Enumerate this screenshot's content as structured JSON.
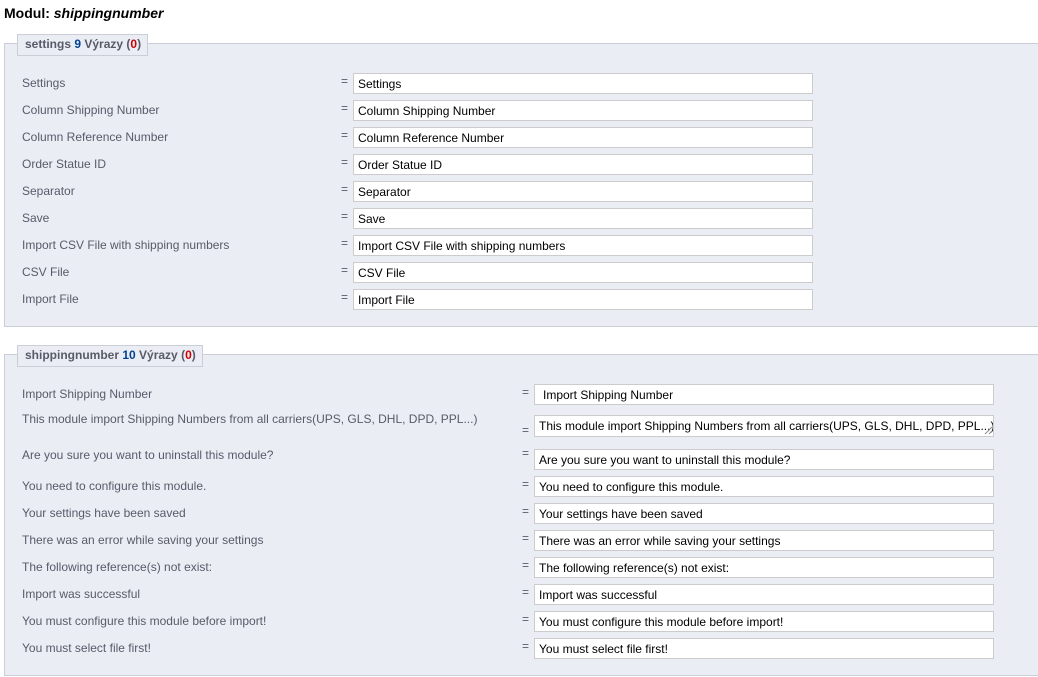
{
  "header": {
    "prefix": "Modul: ",
    "module": "shippingnumber"
  },
  "sections": [
    {
      "name": "settings",
      "count": "9",
      "vyrazy": " Výrazy (",
      "errors": "0",
      "close": ")",
      "rows": [
        {
          "label": "Settings",
          "value": "Settings"
        },
        {
          "label": "Column Shipping Number",
          "value": "Column Shipping Number"
        },
        {
          "label": "Column Reference Number",
          "value": "Column Reference Number"
        },
        {
          "label": "Order Statue ID",
          "value": "Order Statue ID"
        },
        {
          "label": "Separator",
          "value": "Separator"
        },
        {
          "label": "Save",
          "value": "Save"
        },
        {
          "label": "Import CSV File with shipping numbers",
          "value": "Import CSV File with shipping numbers"
        },
        {
          "label": "CSV File",
          "value": "CSV File"
        },
        {
          "label": "Import File",
          "value": "Import File"
        }
      ]
    },
    {
      "name": "shippingnumber",
      "count": "10",
      "vyrazy": " Výrazy (",
      "errors": "0",
      "close": ")",
      "rows": [
        {
          "label": "Import Shipping Number",
          "value": "Import Shipping Number"
        },
        {
          "label": "This module import Shipping Numbers from all carriers(UPS, GLS, DHL, DPD, PPL...)",
          "value": "This module import Shipping Numbers from all carriers(UPS, GLS, DHL, DPD, PPL...)"
        },
        {
          "label": "Are you sure you want to uninstall this module?",
          "value": "Are you sure you want to uninstall this module?"
        },
        {
          "label": "You need to configure this module.",
          "value": "You need to configure this module."
        },
        {
          "label": "Your settings have been saved",
          "value": "Your settings have been saved"
        },
        {
          "label": "There was an error while saving your settings",
          "value": "There was an error while saving your settings"
        },
        {
          "label": "The following reference(s) not exist:",
          "value": "The following reference(s) not exist:"
        },
        {
          "label": "Import was successful",
          "value": "Import was successful"
        },
        {
          "label": "You must configure this module before import!",
          "value": "You must configure this module before import!"
        },
        {
          "label": "You must select file first!",
          "value": "You must select file first!"
        }
      ]
    }
  ],
  "eq_sign": "="
}
